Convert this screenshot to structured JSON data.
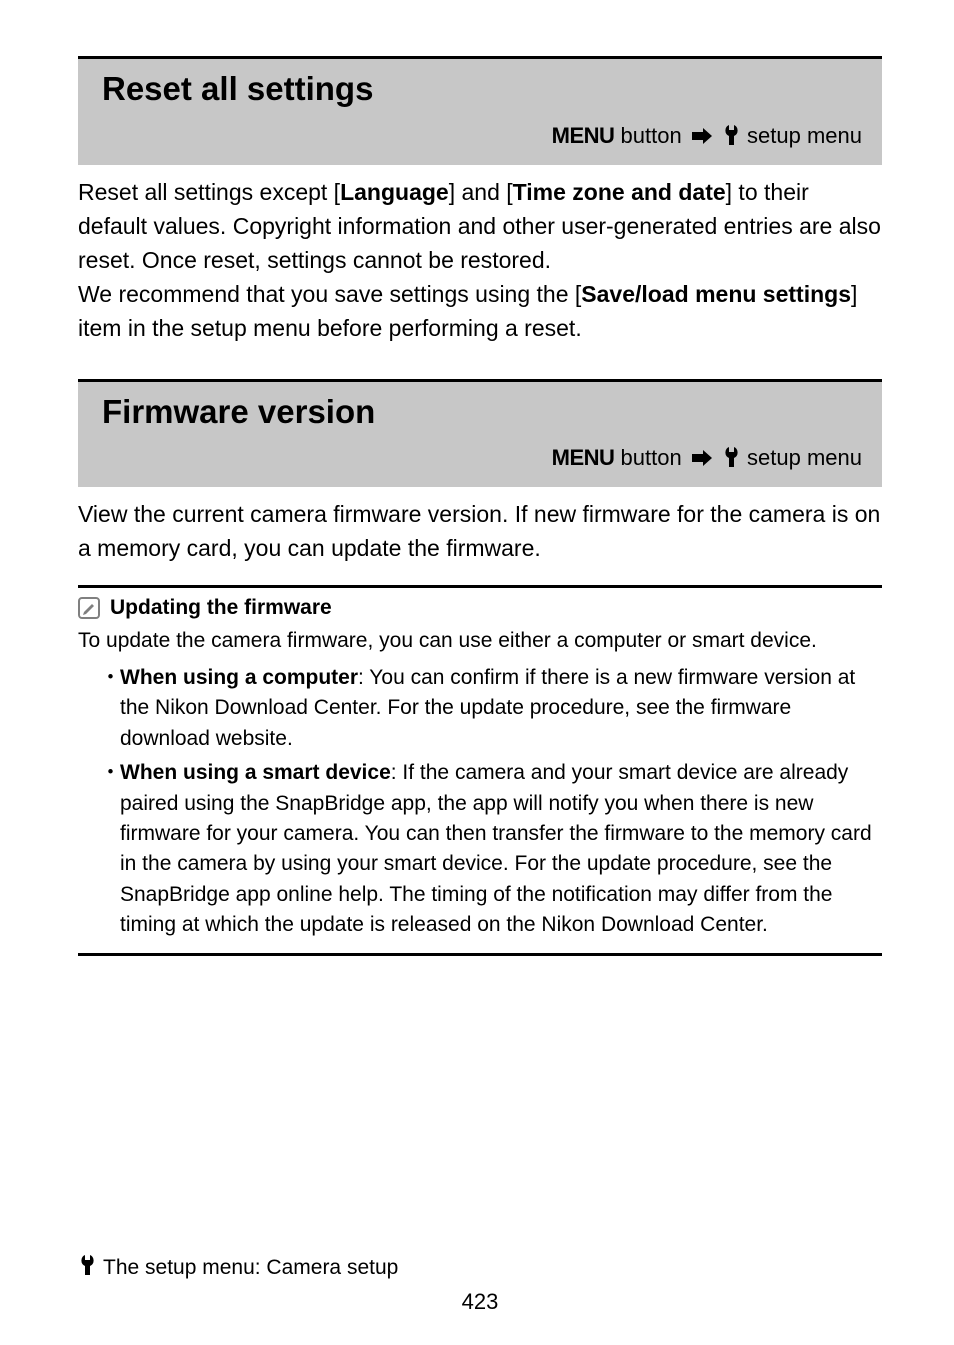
{
  "sections": [
    {
      "title": "Reset all settings",
      "path": {
        "menu": "MENU",
        "button": " button ",
        "setup": " setup menu"
      },
      "paragraphHtml": "Reset all settings except [<b>Language</b>] and [<b>Time zone and date</b>] to their default values. Copyright information and other user-generated entries are also reset. Once reset, settings cannot be restored.<br>We recommend that you save settings using the [<b>Save/load menu settings</b>] item in the setup menu before performing a reset."
    },
    {
      "title": "Firmware version",
      "path": {
        "menu": "MENU",
        "button": " button ",
        "setup": " setup menu"
      },
      "paragraphHtml": "View the current camera firmware version. If new firmware for the camera is on a memory card, you can update the firmware."
    }
  ],
  "tip": {
    "heading": "Updating the firmware",
    "intro": "To update the camera firmware, you can use either a computer or smart device.",
    "items": [
      "<b>When using a computer</b>: You can confirm if there is a new firmware version at the Nikon Download Center. For the update procedure, see the firmware download website.",
      "<b>When using a smart device</b>: If the camera and your smart device are already paired using the SnapBridge app, the app will notify you when there is new firmware for your camera. You can then transfer the firmware to the memory card in the camera by using your smart device. For the update procedure, see the SnapBridge app online help. The timing of the notification may differ from the timing at which the update is released on the Nikon Download Center."
    ]
  },
  "footer": {
    "text": "The setup menu: Camera setup",
    "pageNumber": "423"
  }
}
